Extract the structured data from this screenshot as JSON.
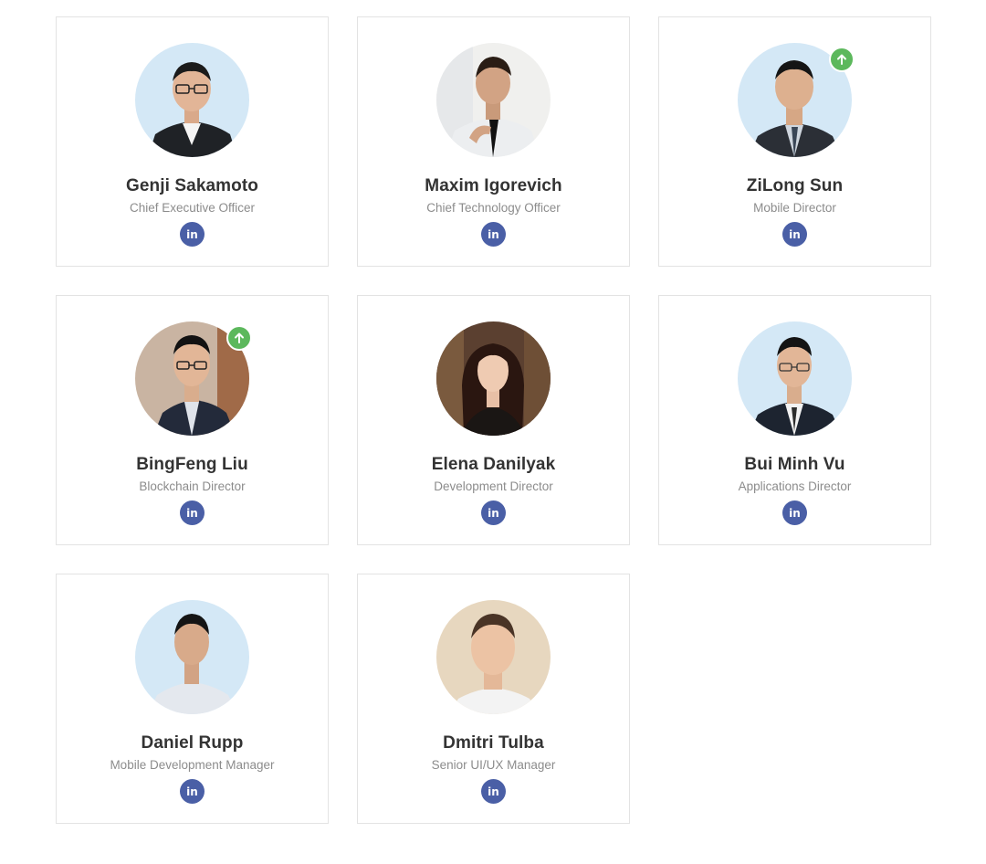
{
  "team": {
    "members": [
      {
        "name": "Genji Sakamoto",
        "title": "Chief Executive Officer",
        "linkedin_label": "in",
        "avatar": "person-photo-icon",
        "badge": false
      },
      {
        "name": "Maxim Igorevich",
        "title": "Chief Technology Officer",
        "linkedin_label": "in",
        "avatar": "person-photo-icon",
        "badge": false
      },
      {
        "name": "ZiLong Sun",
        "title": "Mobile Director",
        "linkedin_label": "in",
        "avatar": "person-photo-icon",
        "badge": true
      },
      {
        "name": "BingFeng Liu",
        "title": "Blockchain Director",
        "linkedin_label": "in",
        "avatar": "person-photo-icon",
        "badge": true
      },
      {
        "name": "Elena Danilyak",
        "title": "Development Director",
        "linkedin_label": "in",
        "avatar": "person-photo-icon",
        "badge": false
      },
      {
        "name": "Bui Minh Vu",
        "title": "Applications Director",
        "linkedin_label": "in",
        "avatar": "person-photo-icon",
        "badge": false
      },
      {
        "name": "Daniel Rupp",
        "title": "Mobile Development Manager",
        "linkedin_label": "in",
        "avatar": "person-photo-icon",
        "badge": false
      },
      {
        "name": "Dmitri Tulba",
        "title": "Senior UI/UX Manager",
        "linkedin_label": "in",
        "avatar": "person-photo-icon",
        "badge": false
      }
    ]
  },
  "colors": {
    "card_border": "#e3e3e3",
    "name_text": "#333333",
    "title_text": "#8c8c8c",
    "linkedin_bg": "#4a5fa6",
    "badge_bg": "#5cb85c"
  }
}
